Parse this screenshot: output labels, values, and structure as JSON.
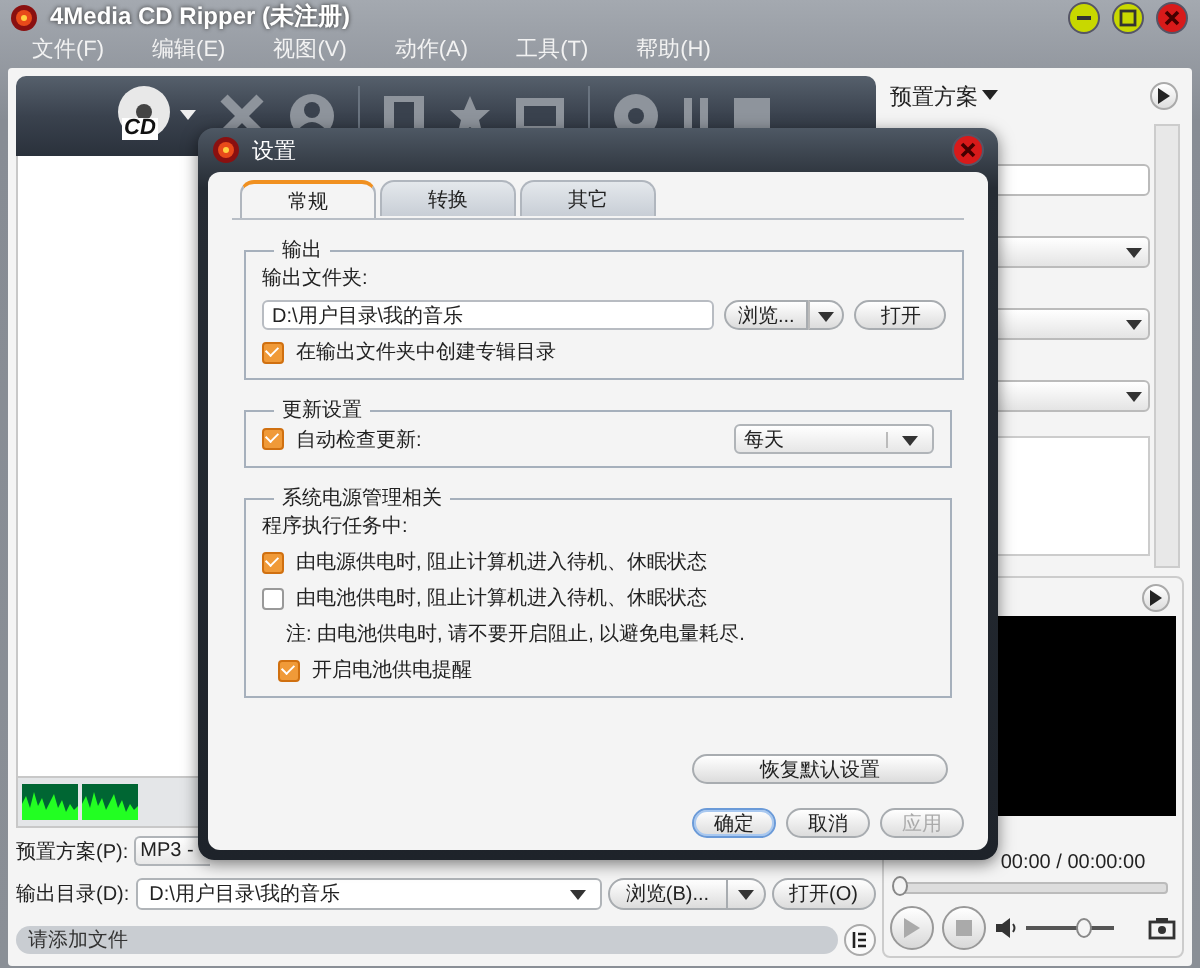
{
  "window": {
    "title": "4Media CD Ripper (未注册)"
  },
  "menu": [
    "文件(F)",
    "编辑(E)",
    "视图(V)",
    "动作(A)",
    "工具(T)",
    "帮助(H)"
  ],
  "toolbar": {
    "cd_label": "CD"
  },
  "main": {
    "preset_label": "预置方案(P):",
    "preset_value": "MP3 -",
    "output_label": "输出目录(D):",
    "output_value": "D:\\用户目录\\我的音乐",
    "browse": "浏览(B)...",
    "open": "打开(O)",
    "status": "请添加文件"
  },
  "right_panel": {
    "preset_menu": "预置方案"
  },
  "player": {
    "time": "00:00 / 00:00:00",
    "seek": {
      "level": 0
    },
    "volume": {
      "level": 0.65
    }
  },
  "dialog": {
    "title": "设置",
    "tabs": [
      {
        "label": "常规",
        "selected": true
      },
      {
        "label": "转换",
        "selected": false
      },
      {
        "label": "其它",
        "selected": false
      }
    ],
    "output_group": {
      "legend": "输出",
      "folder_label": "输出文件夹:",
      "folder_value": "D:\\用户目录\\我的音乐",
      "browse": "浏览...",
      "open": "打开",
      "create_album": {
        "label": "在输出文件夹中创建专辑目录",
        "checked": true
      }
    },
    "update_group": {
      "legend": "更新设置",
      "auto_check": {
        "label": "自动检查更新:",
        "checked": true
      },
      "frequency": "每天"
    },
    "power_group": {
      "legend": "系统电源管理相关",
      "intro": "程序执行任务中:",
      "options": [
        {
          "kind": "checkbox",
          "label": "由电源供电时, 阻止计算机进入待机、休眠状态",
          "checked": true
        },
        {
          "kind": "checkbox",
          "label": "由电池供电时, 阻止计算机进入待机、休眠状态",
          "checked": false
        },
        {
          "kind": "note",
          "label": "注: 由电池供电时, 请不要开启阻止, 以避免电量耗尽."
        },
        {
          "kind": "subcheckbox",
          "label": "开启电池供电提醒",
          "checked": true
        }
      ]
    },
    "restore": "恢复默认设置",
    "buttons": [
      {
        "label": "确定",
        "disabled": false,
        "default": true
      },
      {
        "label": "取消",
        "disabled": false,
        "default": false
      },
      {
        "label": "应用",
        "disabled": true,
        "default": false
      }
    ]
  }
}
